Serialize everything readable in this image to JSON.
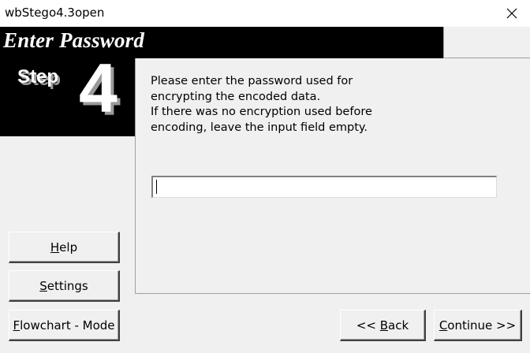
{
  "window": {
    "title": "wbStego4.3open",
    "close_symbol": "✕"
  },
  "header": {
    "heading": "Enter Password"
  },
  "step": {
    "word": "Step",
    "number": "4"
  },
  "instructions": {
    "lines": [
      "Please enter the password used for",
      "encrypting the encoded data.",
      "If there was no encryption used before",
      "encoding, leave the input field empty."
    ]
  },
  "password": {
    "value": ""
  },
  "sidebar_buttons": {
    "help": {
      "first": "H",
      "rest": "elp"
    },
    "settings": {
      "first": "S",
      "rest": "ettings"
    },
    "flowchart": {
      "first": "F",
      "rest": "lowchart - Mode"
    }
  },
  "nav_buttons": {
    "back": {
      "prefix": "<< ",
      "first": "B",
      "rest": "ack"
    },
    "continue": {
      "first": "C",
      "rest": "ontinue >>"
    }
  }
}
